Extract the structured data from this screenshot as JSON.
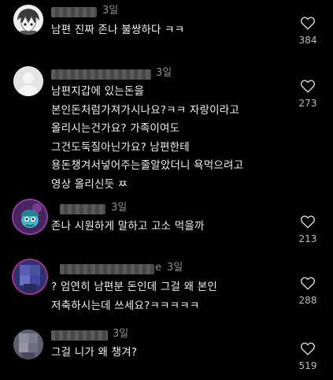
{
  "comments": [
    {
      "time": "3일",
      "lines": [
        "남편 진짜 존나 불쌍하다 ㅋㅋ"
      ],
      "likes": "384",
      "avatar_icon": "anime-character-avatar"
    },
    {
      "time": "3일",
      "lines": [
        "남편지갑에 있는돈을",
        "본인돈처럼가져가시나요?ㅋㅋ 자랑이라고",
        "올리시는건가요? 가족이여도",
        "그건도둑질아닌가요? 남편한테",
        "용돈챙겨서넣어주는줄알았더니 욕먹으려고",
        "영상 올리신듯 ㅉ"
      ],
      "likes": "273",
      "avatar_icon": "default-user-avatar"
    },
    {
      "time": "3일",
      "lines": [
        "존나 시원하게 말하고 고소 먹을까"
      ],
      "likes": "213",
      "avatar_icon": "cartoon-character-avatar"
    },
    {
      "username_tail": "e",
      "time": "3일",
      "lines": [
        "? 엄연히 남편분 돈인데 그걸 왜 본인",
        "저축하시는데 쓰세요?ㅋㅋㅋㅋㅋ"
      ],
      "likes": "288",
      "avatar_icon": "blurred-photo-avatar"
    },
    {
      "time": "3일",
      "lines": [
        "그걸 니가 왜 챙겨?"
      ],
      "likes": "519",
      "avatar_icon": "blurred-photo-avatar"
    }
  ],
  "icons": {
    "like": "heart-outline-icon"
  },
  "colors": {
    "background": "#000000",
    "text": "#f0f0f0",
    "muted": "#8f8f8f"
  }
}
